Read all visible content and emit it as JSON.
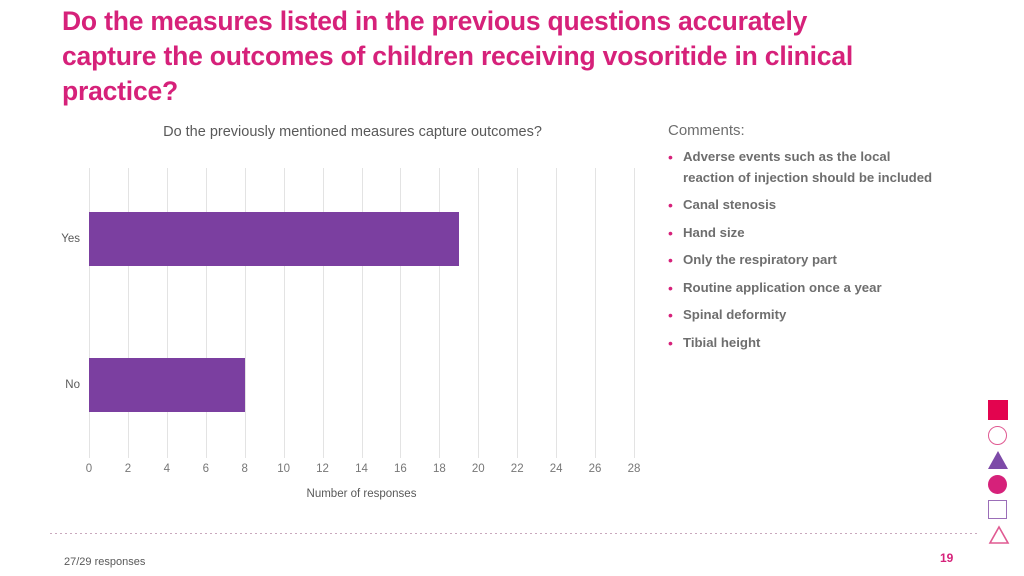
{
  "slide": {
    "title": "Do the measures listed in the previous questions accurately capture the outcomes of children receiving vosoritide in clinical practice?",
    "title_color": "#D6217A",
    "page_number": "19",
    "footer_responses": "27/29 responses"
  },
  "comments": {
    "heading": "Comments:",
    "bullet_glyph": "•",
    "items": [
      "Adverse events such as the local reaction of injection should be included",
      "Canal stenosis",
      "Hand size",
      "Only the respiratory part",
      "Routine application once a year",
      "Spinal deformity",
      "Tibial height"
    ]
  },
  "decorations": [
    {
      "name": "square-filled",
      "color": "#E3044F"
    },
    {
      "name": "circle-outline",
      "color": "#E05A92"
    },
    {
      "name": "triangle-filled",
      "color": "#7D4AA8"
    },
    {
      "name": "circle-filled",
      "color": "#D6217A"
    },
    {
      "name": "square-outline",
      "color": "#9B6EB8"
    },
    {
      "name": "triangle-outline",
      "color": "#E05A92"
    }
  ],
  "chart_data": {
    "type": "bar",
    "orientation": "horizontal",
    "title": "Do the previously mentioned measures capture outcomes?",
    "categories": [
      "Yes",
      "No"
    ],
    "values": [
      19,
      8
    ],
    "xlabel": "Number of responses",
    "ylabel": "",
    "xlim": [
      0,
      28
    ],
    "xticks": [
      0,
      2,
      4,
      6,
      8,
      10,
      12,
      14,
      16,
      18,
      20,
      22,
      24,
      26,
      28
    ],
    "grid": true,
    "grid_axis": "x",
    "legend": false,
    "bar_color": "#7B3FA0",
    "gridline_color": "#E3E3E3"
  }
}
